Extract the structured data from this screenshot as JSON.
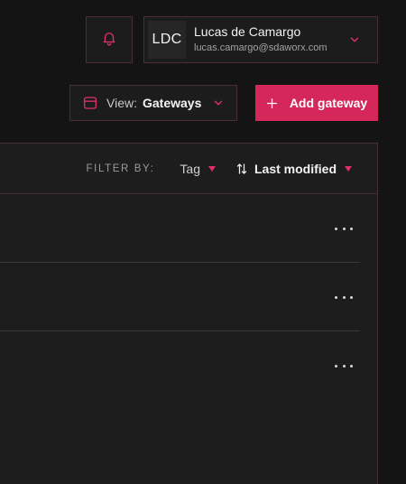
{
  "header": {
    "notifications": {
      "icon": "bell-icon"
    },
    "user": {
      "initials": "LDC",
      "name": "Lucas de Camargo",
      "email": "lucas.camargo@sdaworx.com",
      "menu_icon": "chevron-down-icon"
    }
  },
  "toolbar": {
    "view": {
      "icon": "browser-window-icon",
      "label": "View:",
      "value": "Gateways",
      "chevron_icon": "chevron-down-icon"
    },
    "add_button": {
      "icon": "plus-icon",
      "label": "Add gateway"
    }
  },
  "filters": {
    "label": "FILTER BY:",
    "tag": {
      "label": "Tag",
      "caret_icon": "caret-down-icon"
    },
    "sort": {
      "icon": "sort-arrows-icon",
      "label": "Last modified",
      "caret_icon": "caret-down-icon"
    }
  },
  "rows": [
    {
      "menu_icon": "more-horizontal-icon"
    },
    {
      "menu_icon": "more-horizontal-icon"
    },
    {
      "menu_icon": "more-horizontal-icon"
    }
  ],
  "colors": {
    "accent": "#d6275b",
    "border": "#4a2d35",
    "background": "#141414",
    "panel": "#1d1d1d"
  }
}
